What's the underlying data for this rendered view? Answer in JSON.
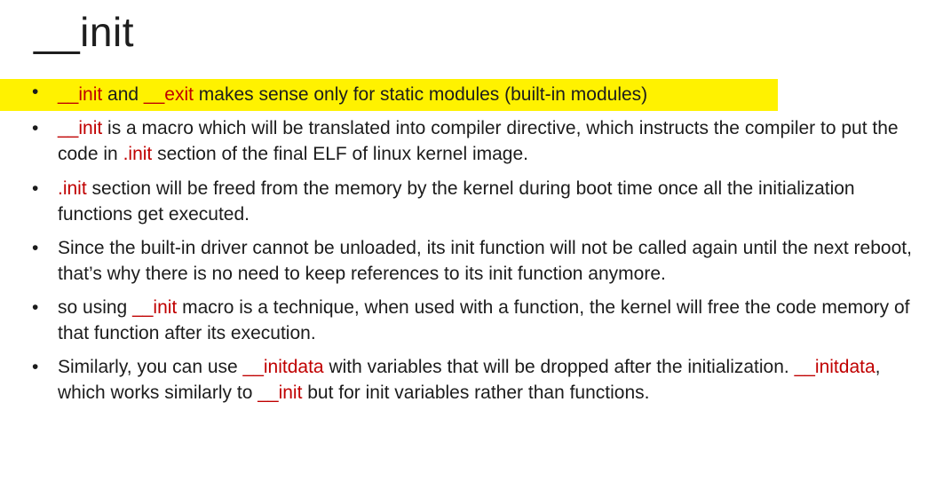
{
  "slide": {
    "title": "__init",
    "bullet_char": "•",
    "colors": {
      "highlight": "#fff200",
      "keyword_red": "#c00000",
      "text": "#1c1c1c"
    },
    "bullets": [
      {
        "segments": [
          {
            "text": "__init",
            "red": true
          },
          {
            "text": " and ",
            "red": false
          },
          {
            "text": "__exit",
            "red": true
          },
          {
            "text": " makes sense only for static modules (built-in modules)",
            "red": false
          }
        ]
      },
      {
        "segments": [
          {
            "text": "__init",
            "red": true
          },
          {
            "text": " is a macro which will be translated into compiler directive, which instructs the compiler to put the code in ",
            "red": false
          },
          {
            "text": ".init",
            "red": true
          },
          {
            "text": " section of the final ELF of linux kernel image.",
            "red": false
          }
        ]
      },
      {
        "segments": [
          {
            "text": ".init",
            "red": true
          },
          {
            "text": " section will be freed from the memory by the kernel during boot time once all the initialization functions get executed.",
            "red": false
          }
        ]
      },
      {
        "segments": [
          {
            "text": "Since the built-in driver cannot be unloaded, its init function will not be called again until the next reboot, that’s why there is no need to keep references to its init function anymore.",
            "red": false
          }
        ]
      },
      {
        "segments": [
          {
            "text": "so using ",
            "red": false
          },
          {
            "text": "__init",
            "red": true
          },
          {
            "text": " macro is a technique, when used with a function, the kernel will free the code memory of that function after its execution.",
            "red": false
          }
        ]
      },
      {
        "segments": [
          {
            "text": "Similarly, you can use ",
            "red": false
          },
          {
            "text": "__initdata",
            "red": true
          },
          {
            "text": " with variables that will be dropped after the initialization. ",
            "red": false
          },
          {
            "text": "__initdata",
            "red": true
          },
          {
            "text": ", which works similarly to ",
            "red": false
          },
          {
            "text": "__init",
            "red": true
          },
          {
            "text": " but for init variables rather than functions.",
            "red": false
          }
        ]
      }
    ]
  }
}
